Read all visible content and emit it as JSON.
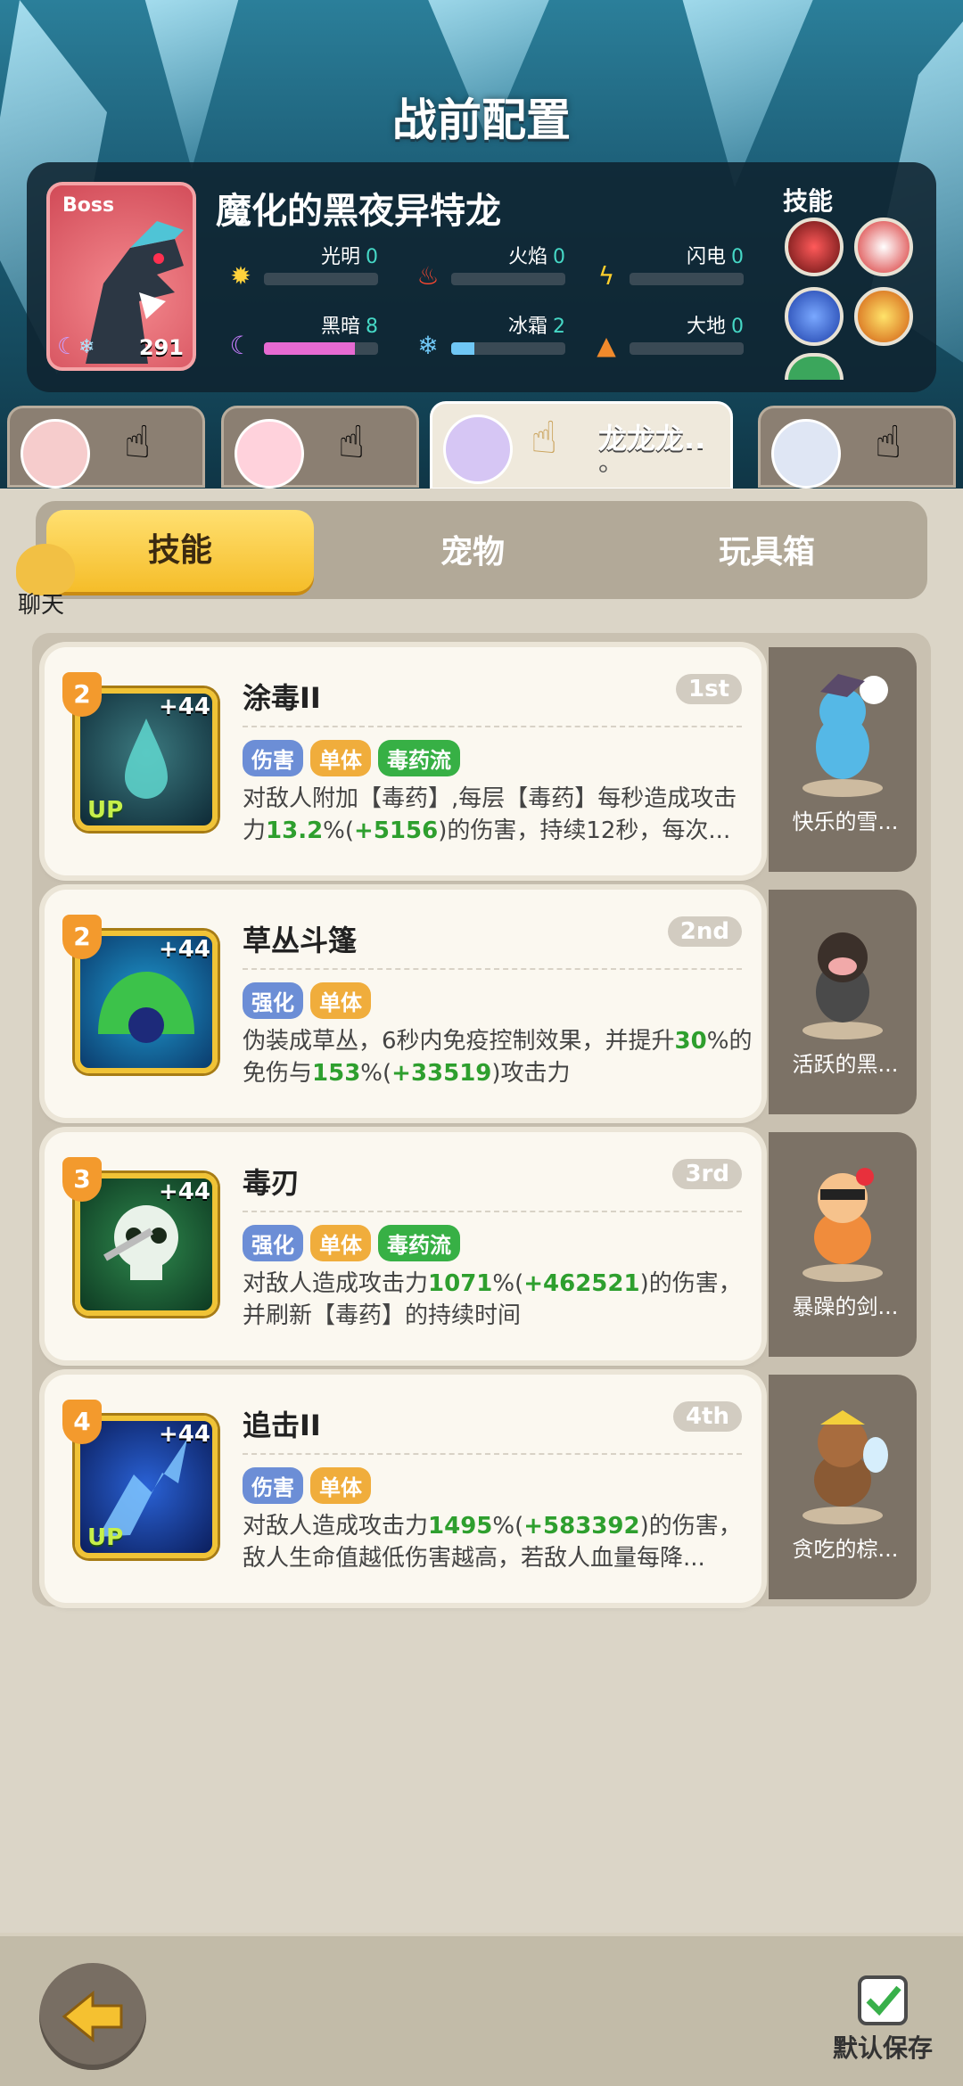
{
  "page": {
    "title": "战前配置"
  },
  "boss": {
    "tag": "Boss",
    "level": "291",
    "name": "魔化的黑夜异特龙",
    "skills_label": "技能",
    "attributes": [
      {
        "label": "光明",
        "value": "0",
        "fill": 0,
        "color": "#ff4fa0"
      },
      {
        "label": "火焰",
        "value": "0",
        "fill": 0,
        "color": "#ff4fa0"
      },
      {
        "label": "闪电",
        "value": "0",
        "fill": 0,
        "color": "#ff4fa0"
      },
      {
        "label": "黑暗",
        "value": "8",
        "fill": 0.8,
        "color": "#e66ad2"
      },
      {
        "label": "冰霜",
        "value": "2",
        "fill": 0.2,
        "color": "#6fc7f5"
      },
      {
        "label": "大地",
        "value": "0",
        "fill": 0,
        "color": "#ff4fa0"
      }
    ]
  },
  "heroes": [
    {
      "name": ""
    },
    {
      "name": ""
    },
    {
      "name": "龙龙龙..",
      "name2": "。"
    },
    {
      "name": ""
    }
  ],
  "categories": {
    "skill": "技能",
    "pet": "宠物",
    "toy": "玩具箱"
  },
  "chat_label": "聊天",
  "skills": [
    {
      "level": "2",
      "plus": "+44",
      "up": "UP",
      "title": "涂毒II",
      "rank": "1st",
      "tags": [
        "伤害",
        "单体",
        "毒药流"
      ],
      "desc_a": "对敌人附加【毒药】,每层【毒药】每秒造成攻击力",
      "desc_g1": "13.2",
      "desc_b": "%(",
      "desc_g2": "+5156",
      "desc_c": ")的伤害，持续12秒，每次...",
      "pet": "快乐的雪..."
    },
    {
      "level": "2",
      "plus": "+44",
      "up": "",
      "title": "草丛斗篷",
      "rank": "2nd",
      "tags": [
        "强化",
        "单体"
      ],
      "desc_a": "伪装成草丛，6秒内免疫控制效果，并提升",
      "desc_g1": "30",
      "desc_b": "%的免伤与",
      "desc_g2": "153",
      "desc_c": "%(",
      "desc_g3": "+33519",
      "desc_d": ")攻击力",
      "pet": "活跃的黑..."
    },
    {
      "level": "3",
      "plus": "+44",
      "up": "",
      "title": "毒刃",
      "rank": "3rd",
      "tags": [
        "强化",
        "单体",
        "毒药流"
      ],
      "desc_a": "对敌人造成攻击力",
      "desc_g1": "1071",
      "desc_b": "%(",
      "desc_g2": "+462521",
      "desc_c": ")的伤害，并刷新【毒药】的持续时间",
      "pet": "暴躁的剑..."
    },
    {
      "level": "4",
      "plus": "+44",
      "up": "UP",
      "title": "追击II",
      "rank": "4th",
      "tags": [
        "伤害",
        "单体"
      ],
      "desc_a": "对敌人造成攻击力",
      "desc_g1": "1495",
      "desc_b": "%(",
      "desc_g2": "+583392",
      "desc_c": ")的伤害，敌人生命值越低伤害越高，若敌人血量每降...",
      "pet": "贪吃的棕..."
    }
  ],
  "footer": {
    "save_label": "默认保存"
  }
}
